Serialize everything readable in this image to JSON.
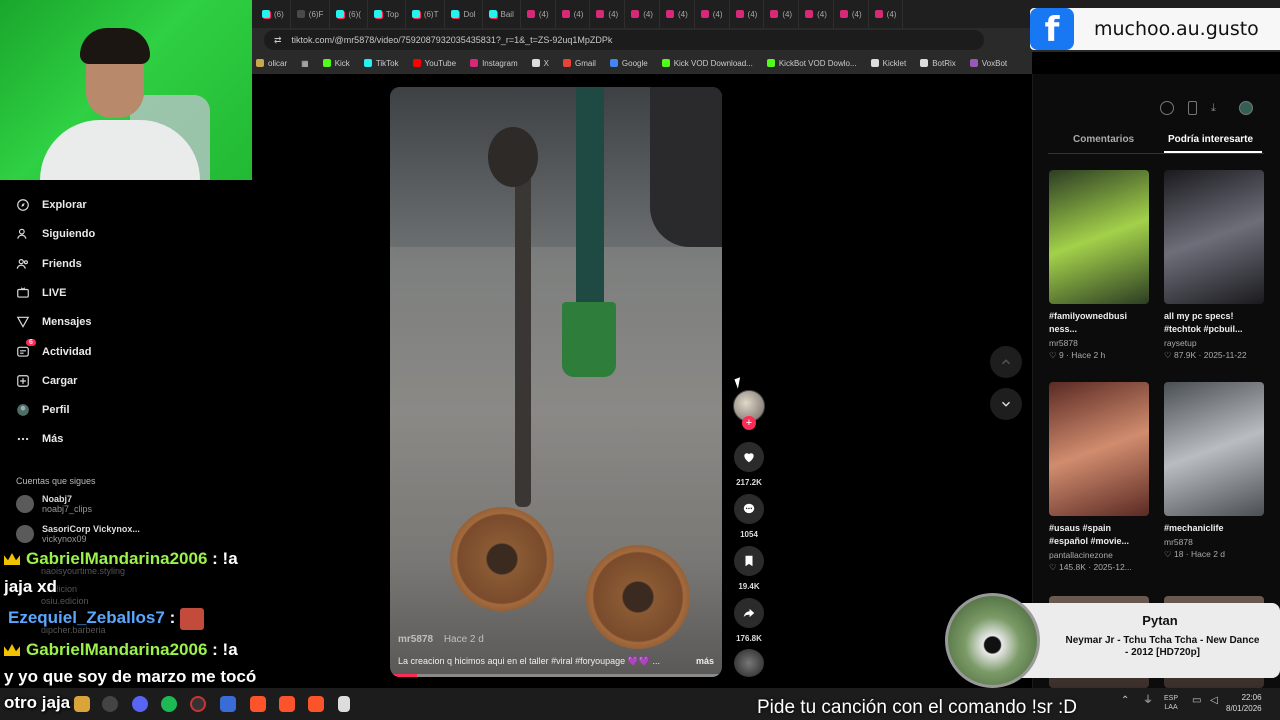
{
  "browser": {
    "tabs": [
      {
        "icon": "tiktok",
        "label": "(6)"
      },
      {
        "icon": "chrome",
        "label": "(6)F"
      },
      {
        "icon": "tiktok",
        "label": "(6)("
      },
      {
        "icon": "tiktok",
        "label": "Top"
      },
      {
        "icon": "tiktok",
        "label": "(6)T"
      },
      {
        "icon": "tiktok",
        "label": "Dol"
      },
      {
        "icon": "tiktok",
        "label": "Bail"
      },
      {
        "icon": "instagram",
        "label": "(4)"
      },
      {
        "icon": "instagram",
        "label": "(4)"
      },
      {
        "icon": "instagram",
        "label": "(4)"
      },
      {
        "icon": "instagram",
        "label": "(4)"
      },
      {
        "icon": "instagram",
        "label": "(4)"
      },
      {
        "icon": "instagram",
        "label": "(4)"
      },
      {
        "icon": "instagram",
        "label": "(4)"
      },
      {
        "icon": "instagram",
        "label": "(4)"
      },
      {
        "icon": "instagram",
        "label": "(4)"
      },
      {
        "icon": "instagram",
        "label": "(4)"
      },
      {
        "icon": "instagram",
        "label": "(4)"
      }
    ],
    "url": "tiktok.com/@mr5878/video/7592087932035435831?_r=1&_t=ZS-92uq1MpZDPk",
    "bookmarks": [
      {
        "label": "olicar",
        "color": "#c7a84a"
      },
      {
        "label": "Kick",
        "color": "#53fc18"
      },
      {
        "label": "TikTok",
        "color": "#25f4ee"
      },
      {
        "label": "YouTube",
        "color": "#ff0000"
      },
      {
        "label": "Instagram",
        "color": "#d62976"
      },
      {
        "label": "X",
        "color": "#dddddd"
      },
      {
        "label": "Gmail",
        "color": "#ea4335"
      },
      {
        "label": "Google",
        "color": "#4285f4"
      },
      {
        "label": "Kick VOD Download...",
        "color": "#53fc18"
      },
      {
        "label": "KickBot VOD Dowlo...",
        "color": "#53fc18"
      },
      {
        "label": "Kicklet",
        "color": "#dddddd"
      },
      {
        "label": "BotRix",
        "color": "#dddddd"
      },
      {
        "label": "VoxBot",
        "color": "#9b59b6"
      }
    ]
  },
  "stream_overlay": {
    "facebook_handle": "muchoo.au.gusto",
    "facebook_logo_letter": "f",
    "song_artist": "Pytan",
    "song_title": "Neymar Jr - Tchu Tcha Tcha - New Dance - 2012 [HD720p]",
    "sr_banner": "Pide tu canción con el comando !sr :D"
  },
  "sidebar": {
    "nav": [
      {
        "label": "Explorar",
        "icon": "compass-icon"
      },
      {
        "label": "Siguiendo",
        "icon": "user-follow-icon"
      },
      {
        "label": "Friends",
        "icon": "friends-icon"
      },
      {
        "label": "LIVE",
        "icon": "live-icon"
      },
      {
        "label": "Mensajes",
        "icon": "message-icon"
      },
      {
        "label": "Actividad",
        "icon": "activity-icon",
        "badge": "6"
      },
      {
        "label": "Cargar",
        "icon": "upload-icon"
      },
      {
        "label": "Perfil",
        "icon": "avatar-icon"
      },
      {
        "label": "Más",
        "icon": "more-icon"
      }
    ],
    "following_title": "Cuentas que sigues",
    "accounts": [
      {
        "name": "Noabj7",
        "handle": "noabj7_clips"
      },
      {
        "name": "SasoriCorp Vickynox...",
        "handle": "vickynox09"
      }
    ],
    "faded_handles": [
      "naoisyourtime.styling",
      "u.edicion",
      "osiu.edicion",
      "dipcher.barberia"
    ]
  },
  "chat": [
    {
      "user": "GabrielMandarina2006",
      "text": ": !a",
      "color": "#9bf24a",
      "crown": true
    },
    {
      "user": "",
      "text": "jaja xd",
      "color": "#ffffff",
      "crown": false
    },
    {
      "user": "Ezequiel_Zeballos7",
      "text": ":",
      "color": "#5aa7ff",
      "crown": false,
      "emote": true
    },
    {
      "user": "GabrielMandarina2006",
      "text": ": !a",
      "color": "#9bf24a",
      "crown": true
    },
    {
      "user": "",
      "text": "y yo que soy de marzo me tocó",
      "color": "#ffffff",
      "crown": false
    },
    {
      "user": "",
      "text": "otro jaja",
      "color": "#ffffff",
      "crown": false
    }
  ],
  "video": {
    "author": "mr5878",
    "posted": "Hace 2 d",
    "caption": "La creacion q hicimos aqui en el taller #viral #foryoupage 💜💜 ...",
    "more": "más",
    "progress": 0.08
  },
  "actions": {
    "likes": "217.2K",
    "comments": "1054",
    "saves": "19.4K",
    "shares": "176.8K"
  },
  "panel": {
    "tab_comments": "Comentarios",
    "tab_suggest": "Podría interesarte",
    "cards": [
      {
        "title": "#familyownedbusi ness...",
        "author": "mr5878",
        "meta": "♡ 9 · Hace 2 h",
        "palette": [
          "#2c3d24",
          "#a3d14a"
        ]
      },
      {
        "title": "all my pc specs! #techtok #pcbuil...",
        "author": "raysetup",
        "meta": "♡ 87.9K · 2025-11-22",
        "palette": [
          "#1a1a1e",
          "#6e6e7a"
        ]
      },
      {
        "title": "#usaus #spain #español #movie...",
        "author": "pantallacinezone",
        "meta": "♡ 145.8K · 2025-12...",
        "palette": [
          "#5a2a24",
          "#d18c6e"
        ]
      },
      {
        "title": "#mechaniclife",
        "author": "mr5878",
        "meta": "♡ 18 · Hace 2 d",
        "palette": [
          "#4a4f54",
          "#b9bcc0"
        ]
      }
    ]
  },
  "taskbar": {
    "lang_top": "ESP",
    "lang_bottom": "LAA",
    "time": "22:06",
    "date": "8/01/2026"
  }
}
